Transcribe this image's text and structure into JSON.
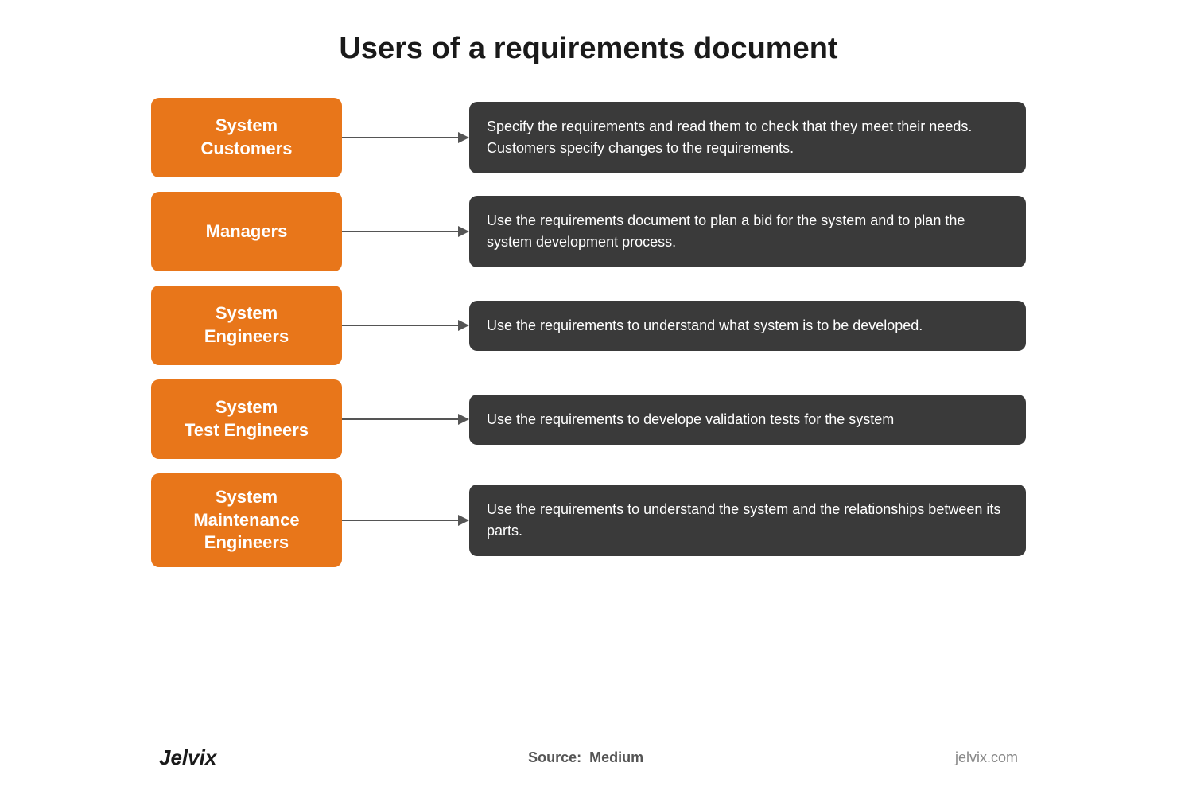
{
  "title": "Users of a requirements document",
  "rows": [
    {
      "id": "system-customers",
      "label": "System\nCustomers",
      "description": "Specify the requirements and read them to check that they meet their needs. Customers specify changes to the requirements."
    },
    {
      "id": "managers",
      "label": "Managers",
      "description": "Use the requirements document to plan a bid for the system and to plan the system development process."
    },
    {
      "id": "system-engineers",
      "label": "System\nEngineers",
      "description": "Use the requirements to understand what system is to be developed."
    },
    {
      "id": "system-test-engineers",
      "label": "System\nTest Engineers",
      "description": "Use the requirements to develope validation tests for the system"
    },
    {
      "id": "system-maintenance-engineers",
      "label": "System\nMaintenance\nEngineers",
      "description": "Use the requirements to understand the system and the relationships between its parts."
    }
  ],
  "footer": {
    "left": "Jelvix",
    "source_label": "Source:",
    "source_value": "Medium",
    "right": "jelvix.com"
  }
}
